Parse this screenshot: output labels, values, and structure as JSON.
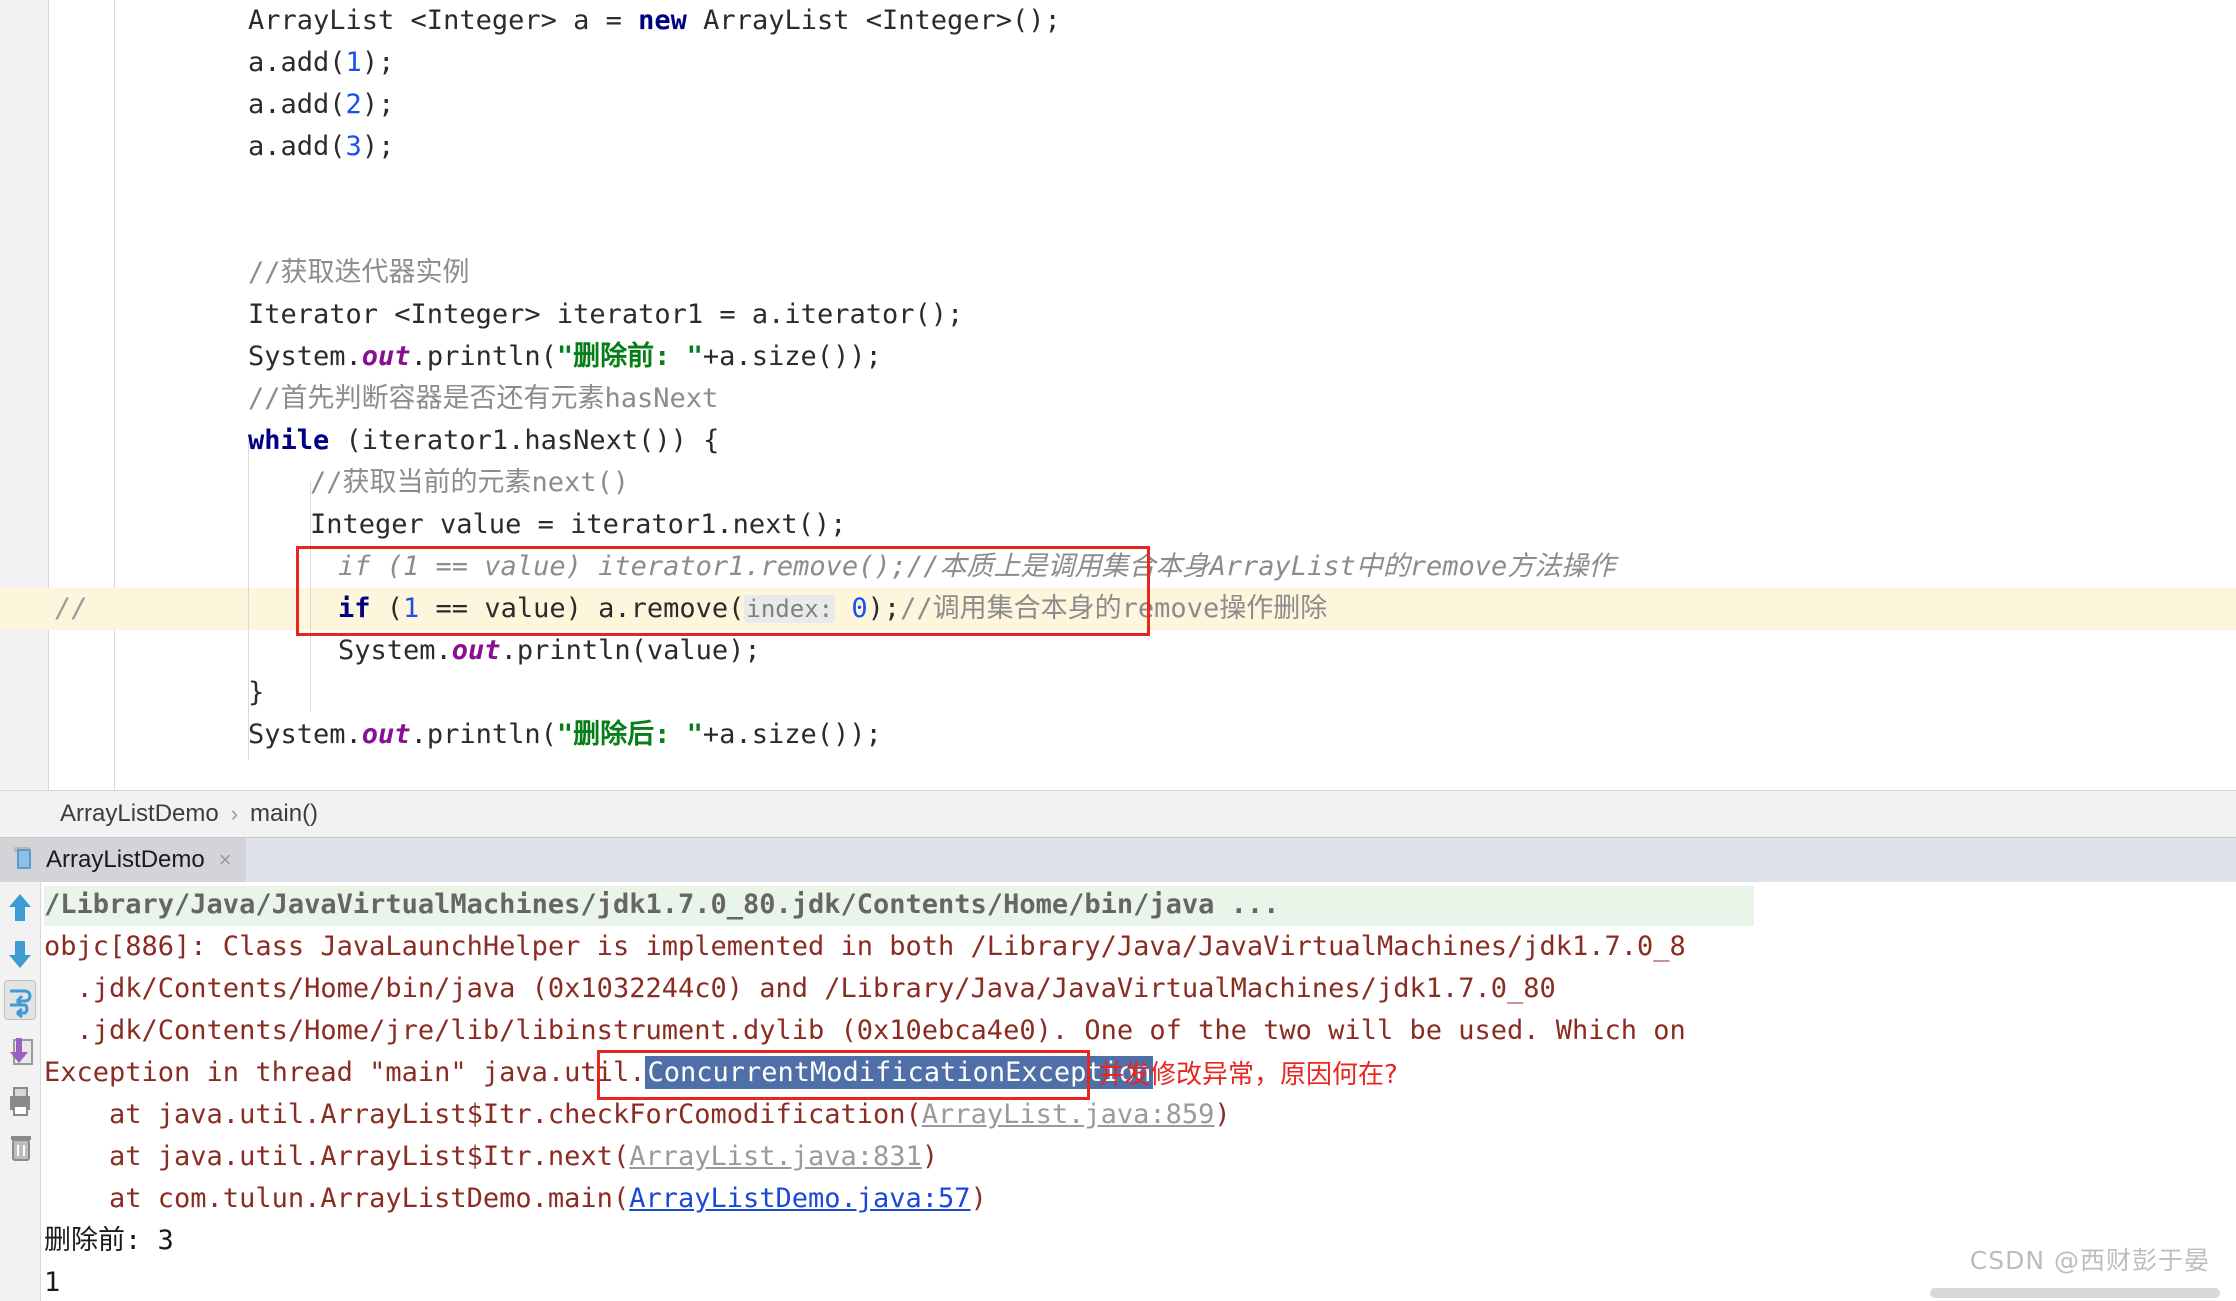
{
  "editor": {
    "lines": [
      {
        "id": "l1",
        "text": "ArrayList <Integer> a = new ArrayList <Integer>();"
      },
      {
        "id": "l2",
        "text": "a.add(1);"
      },
      {
        "id": "l3",
        "text": "a.add(2);"
      },
      {
        "id": "l4",
        "text": "a.add(3);"
      },
      {
        "id": "l5",
        "text": ""
      },
      {
        "id": "l6",
        "text": "//获取迭代器实例"
      },
      {
        "id": "l7",
        "text": "Iterator <Integer> iterator1 = a.iterator();"
      },
      {
        "id": "l8",
        "text": "System.out.println(\"删除前: \"+a.size());"
      },
      {
        "id": "l9",
        "text": "//首先判断容器是否还有元素hasNext"
      },
      {
        "id": "l10",
        "text": "while (iterator1.hasNext()) {"
      },
      {
        "id": "l11",
        "text": "//获取当前的元素next()"
      },
      {
        "id": "l12",
        "text": "Integer value = iterator1.next();"
      },
      {
        "id": "l13",
        "text": "//    if (1 == value) iterator1.remove();//本质上是调用集合本身ArrayList中的remove方法操作"
      },
      {
        "id": "l14",
        "text": "if (1 == value) a.remove( index: 0);//调用集合本身的remove操作删除"
      },
      {
        "id": "l15",
        "text": "System.out.println(value);"
      },
      {
        "id": "l16",
        "text": "}"
      },
      {
        "id": "l17",
        "text": "System.out.println(\"删除后: \"+a.size());"
      }
    ],
    "tokens": {
      "kw_new": "new",
      "kw_while": "while",
      "kw_if": "if",
      "type_arraylist": "ArrayList",
      "type_integer": "Integer",
      "type_iterator": "Iterator",
      "var_a": "a",
      "var_value": "value",
      "var_iterator1": "iterator1",
      "field_out": "out",
      "str_before": "\"删除前: \"",
      "str_after": "\"删除后: \"",
      "param_hint_index": "index:",
      "comment_get_iterator": "//获取迭代器实例",
      "comment_hasnext": "//首先判断容器是否还有元素hasNext",
      "comment_next": "//获取当前的元素next()",
      "comment_remove_essence": "//本质上是调用集合本身ArrayList中的remove方法操作",
      "comment_remove_call": "//调用集合本身的remove操作删除",
      "commented_out_marker": "//",
      "commented_out_code": "if (1 == value) iterator1.remove();"
    },
    "colors": {
      "keyword": "#000080",
      "number": "#1750eb",
      "string": "#067d17",
      "static_field": "#871094",
      "comment": "#8c8c8c",
      "highlight_line_bg": "#fdf6dd",
      "annotation_box": "#e8251e"
    }
  },
  "breadcrumb": {
    "class_name": "ArrayListDemo",
    "separator": "›",
    "method_name": "main()"
  },
  "run_tab": {
    "label": "ArrayListDemo",
    "close_glyph": "×",
    "icon": "java-class-icon"
  },
  "console_toolbar": {
    "buttons": [
      {
        "name": "up-arrow-icon",
        "title": "Up the Stack Trace"
      },
      {
        "name": "down-arrow-icon",
        "title": "Down the Stack Trace"
      },
      {
        "name": "soft-wrap-icon",
        "title": "Soft-Wrap"
      },
      {
        "name": "export-icon",
        "title": "Export to Text File"
      },
      {
        "name": "print-icon",
        "title": "Print"
      },
      {
        "name": "trash-icon",
        "title": "Clear All"
      }
    ]
  },
  "console": {
    "command_line": "/Library/Java/JavaVirtualMachines/jdk1.7.0_80.jdk/Contents/Home/bin/java ...",
    "lines": [
      {
        "id": "c1",
        "text": "objc[886]: Class JavaLaunchHelper is implemented in both /Library/Java/JavaVirtualMachines/jdk1.7.0_8"
      },
      {
        "id": "c2",
        "text": "  .jdk/Contents/Home/bin/java (0x1032244c0) and /Library/Java/JavaVirtualMachines/jdk1.7.0_80"
      },
      {
        "id": "c3",
        "text": "  .jdk/Contents/Home/jre/lib/libinstrument.dylib (0x10ebca4e0). One of the two will be used. Which on"
      }
    ],
    "exception": {
      "prefix": "Exception in thread \"main\" java.util.",
      "name": "ConcurrentModificationException",
      "annotation": "并发修改异常，原因何在?"
    },
    "stack": [
      {
        "id": "s1",
        "prefix": "    at java.util.ArrayList$Itr.checkForComodification(",
        "link": "ArrayList.java:859",
        "link_style": "gray",
        "suffix": ")"
      },
      {
        "id": "s2",
        "prefix": "    at java.util.ArrayList$Itr.next(",
        "link": "ArrayList.java:831",
        "link_style": "gray",
        "suffix": ")"
      },
      {
        "id": "s3",
        "prefix": "    at com.tulun.ArrayListDemo.main(",
        "link": "ArrayListDemo.java:57",
        "link_style": "blue",
        "suffix": ")"
      }
    ],
    "program_output": [
      {
        "id": "p1",
        "text": "删除前: 3"
      },
      {
        "id": "p2",
        "text": "1"
      }
    ]
  },
  "watermark": {
    "text": "CSDN @西财彭于晏"
  }
}
